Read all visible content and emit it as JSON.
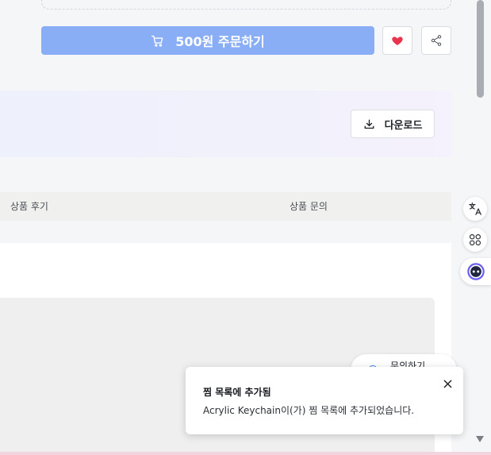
{
  "order": {
    "label": "500원 주문하기",
    "icon": "cart-icon"
  },
  "actions": {
    "favorite_icon": "heart-icon",
    "share_icon": "share-icon",
    "favorite_color": "#e8344d"
  },
  "download": {
    "label": "다운로드",
    "icon": "download-icon"
  },
  "tabs": {
    "items": [
      {
        "label": "상품 후기"
      },
      {
        "label": "상품 문의"
      }
    ]
  },
  "inquiry": {
    "label": "문의하기"
  },
  "toast": {
    "title": "찜 목록에 추가됨",
    "message": "Acrylic Keychain이(가) 찜 목록에 추가되었습니다."
  },
  "sidebar_tools": {
    "items": [
      "translate-icon",
      "apps-icon",
      "assistant-icon"
    ]
  },
  "colors": {
    "accent_disabled": "#8aaef5",
    "favorite": "#e8344d"
  }
}
